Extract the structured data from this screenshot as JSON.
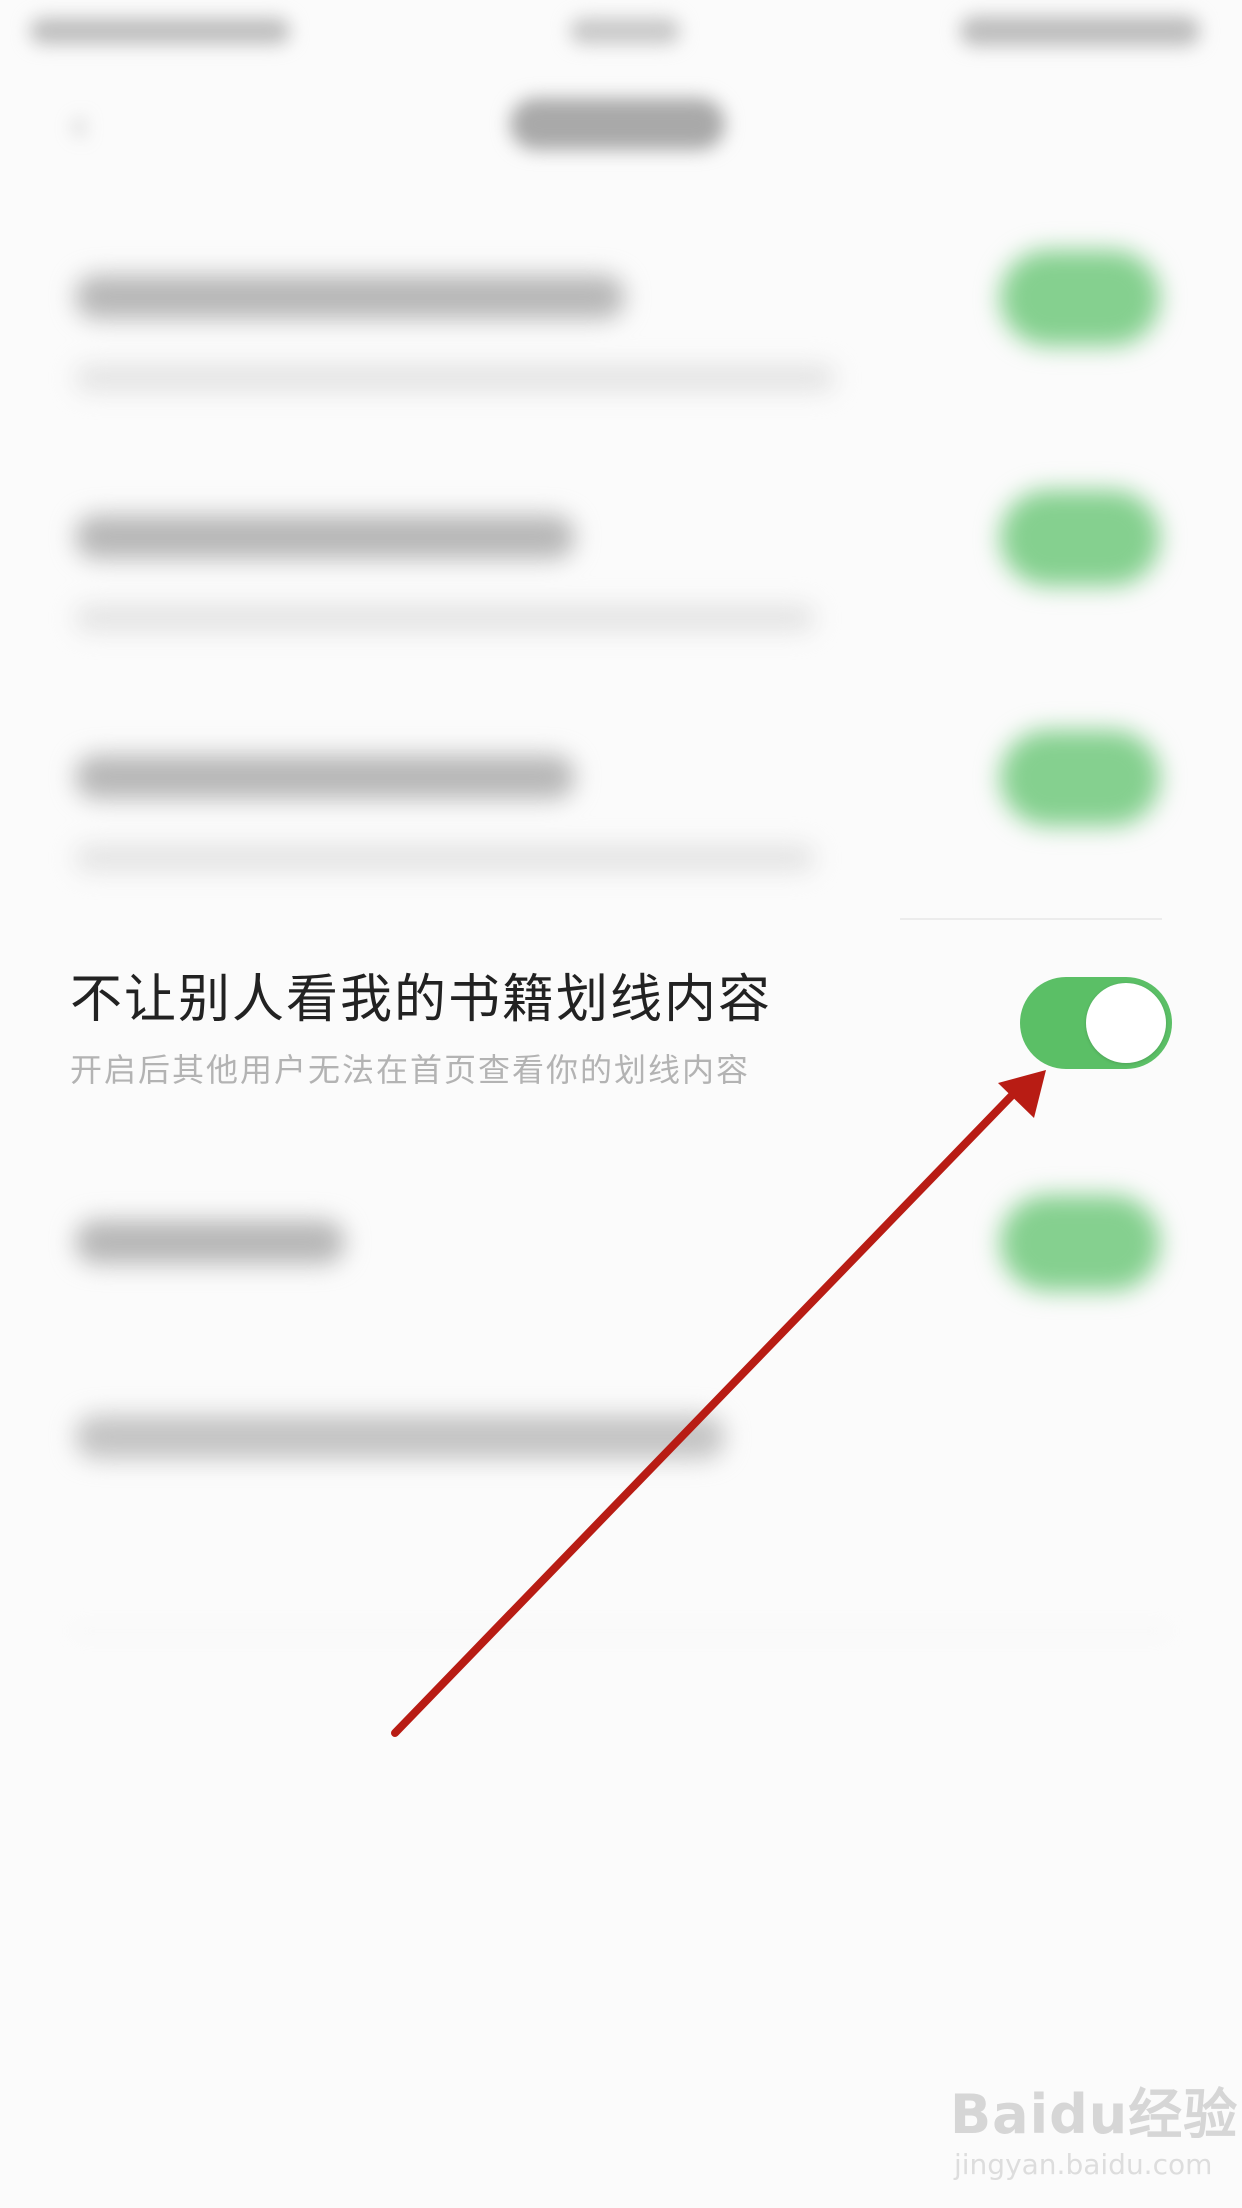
{
  "setting": {
    "title": "不让别人看我的书籍划线内容",
    "subtitle": "开启后其他用户无法在首页查看你的划线内容",
    "toggle_state": "on",
    "toggle_color": "#5bbf66"
  },
  "annotation": {
    "arrow_color": "#b81c14"
  },
  "watermark": {
    "logo": "Baidu经验",
    "url": "jingyan.baidu.com"
  },
  "icons": {
    "back": "back-arrow-icon"
  }
}
